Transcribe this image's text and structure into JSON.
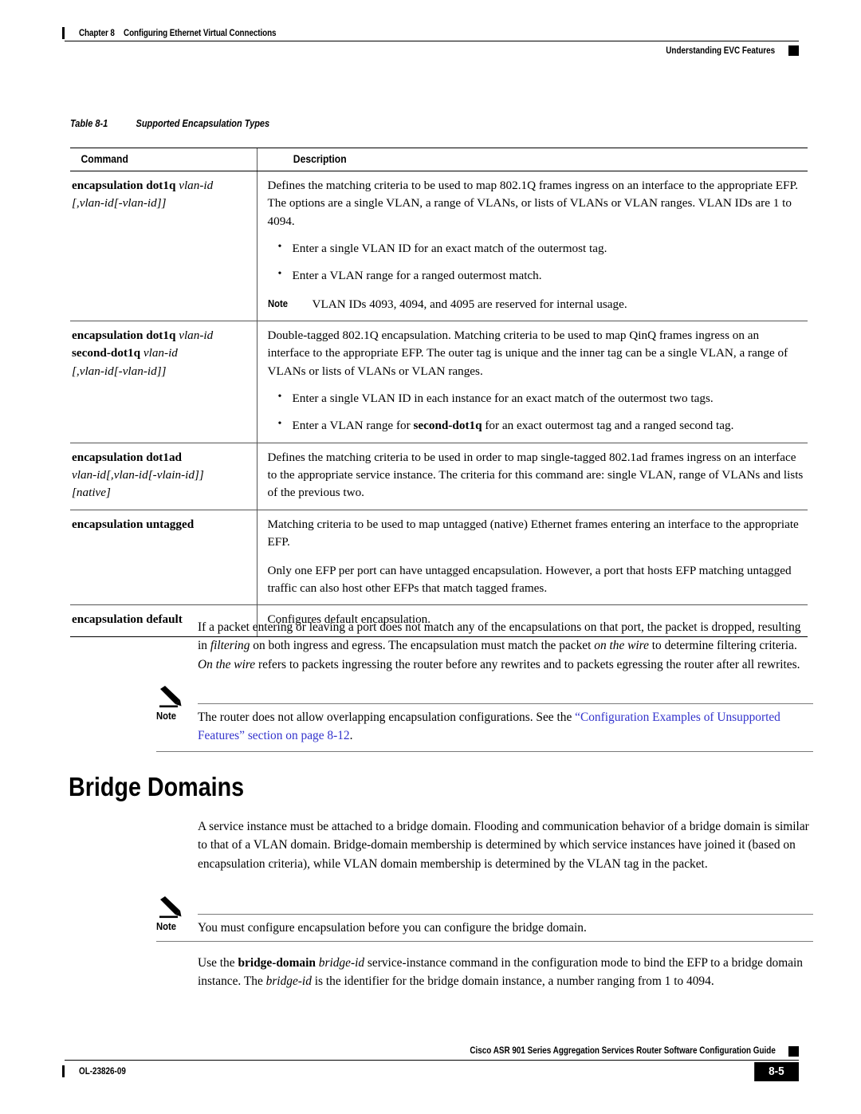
{
  "header": {
    "chapter_number": "Chapter 8",
    "chapter_title": "Configuring Ethernet Virtual Connections",
    "section_title": "Understanding EVC Features"
  },
  "table": {
    "label": "Table 8-1",
    "caption": "Supported Encapsulation Types",
    "columns": [
      "Command",
      "Description"
    ],
    "rows": [
      {
        "command_bold": "encapsulation dot1q ",
        "command_italic": "vlan-id",
        "command_line2": "[,vlan-id[-vlan-id]]",
        "desc_para": "Defines the matching criteria to be used to map 802.1Q frames ingress on an interface to the appropriate EFP. The options are a single VLAN, a range of VLANs, or lists of VLANs or VLAN ranges. VLAN IDs are 1 to 4094.",
        "bullets": [
          "Enter a single VLAN ID for an exact match of the outermost tag.",
          "Enter a VLAN range for a ranged outermost match."
        ],
        "note_label": "Note",
        "note_text": "VLAN IDs 4093, 4094, and 4095 are reserved for internal usage."
      },
      {
        "command_bold": "encapsulation dot1q ",
        "command_italic": "vlan-id",
        "command_bold2": "second-dot1q ",
        "command_italic2": "vlan-id",
        "command_line3": "[,vlan-id[-vlan-id]]",
        "desc_para": "Double-tagged 802.1Q encapsulation. Matching criteria to be used to map QinQ frames ingress on an interface to the appropriate EFP. The outer tag is unique and the inner tag can be a single VLAN, a range of VLANs or lists of VLANs or VLAN ranges.",
        "bullets": [
          "Enter a single VLAN ID in each instance for an exact match of the outermost two tags."
        ],
        "bullet_rich_pre": "Enter a VLAN range for ",
        "bullet_rich_bold": "second-dot1q",
        "bullet_rich_post": " for an exact outermost tag and a ranged second tag."
      },
      {
        "command_bold": "encapsulation dot1ad",
        "command_line2_italic": "vlan-id[,vlan-id[-vlain-id]]",
        "command_line3_italic": "[native]",
        "desc_para": "Defines the matching criteria to be used in order to map single-tagged 802.1ad frames ingress on an interface to the appropriate service instance. The criteria for this command are: single VLAN, range of VLANs and lists of the previous two."
      },
      {
        "command_bold": "encapsulation untagged",
        "desc_para": "Matching criteria to be used to map untagged (native) Ethernet frames entering an interface to the appropriate EFP.",
        "desc_para2": "Only one EFP per port can have untagged encapsulation. However, a port that hosts EFP matching untagged traffic can also host other EFPs that match tagged frames."
      },
      {
        "command_bold": "encapsulation default",
        "desc_para": "Configures default encapsulation."
      }
    ]
  },
  "body": {
    "para_filtering": {
      "t1": "If a packet entering or leaving a port does not match any of the encapsulations on that port, the packet is dropped, resulting in ",
      "i1": "filtering",
      "t2": " on both ingress and egress. The encapsulation must match the packet ",
      "i2": "on the wire",
      "t3": " to determine filtering criteria. ",
      "i3": "On the wire",
      "t4": " refers to packets ingressing the router before any rewrites and to packets egressing the router after all rewrites."
    },
    "note1": {
      "label": "Note",
      "text_pre": "The router does not allow overlapping encapsulation configurations. See the ",
      "link": "“Configuration Examples of Unsupported Features” section on page 8-12",
      "text_post": "."
    },
    "heading": "Bridge Domains",
    "para_bridge": "A service instance must be attached to a bridge domain. Flooding and communication behavior of a bridge domain is similar to that of a VLAN domain. Bridge-domain membership is determined by which service instances have joined it (based on encapsulation criteria), while VLAN domain membership is determined by the VLAN tag in the packet.",
    "note2": {
      "label": "Note",
      "text": "You must configure encapsulation before you can configure the bridge domain."
    },
    "para_usebd": {
      "t1": "Use the ",
      "b1": "bridge-domain",
      "t2": " ",
      "i1": "bridge-id",
      "t3": " service-instance command in the configuration mode to bind the EFP to a bridge domain instance. The ",
      "i2": "bridge-id",
      "t4": " is the identifier for the bridge domain instance, a number ranging from 1 to 4094."
    }
  },
  "footer": {
    "doc_id": "OL-23826-09",
    "guide_title": "Cisco ASR 901 Series Aggregation Services Router Software Configuration Guide",
    "page_number": "8-5"
  },
  "colors": {
    "link": "#3333CC",
    "rule": "#000000",
    "table_rule_light": "#555555",
    "note_rule": "#7a7a7a"
  }
}
